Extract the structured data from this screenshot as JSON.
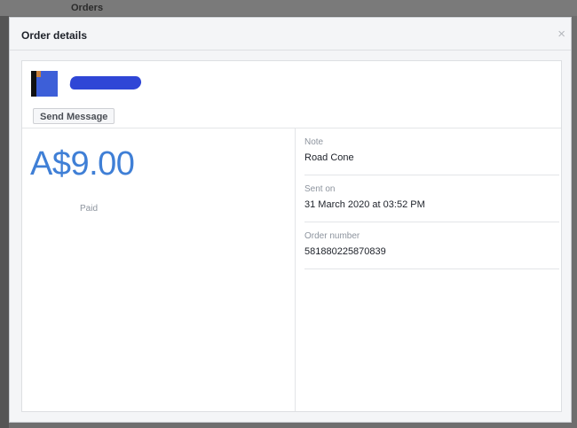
{
  "background": {
    "page_title": "Orders"
  },
  "dialog": {
    "title": "Order details",
    "close_glyph": "×"
  },
  "customer": {
    "send_message_label": "Send Message"
  },
  "order": {
    "amount": "A$9.00",
    "status": "Paid",
    "fields": [
      {
        "label": "Note",
        "value": "Road Cone"
      },
      {
        "label": "Sent on",
        "value": "31 March 2020 at 03:52 PM"
      },
      {
        "label": "Order number",
        "value": "581880225870839"
      }
    ]
  },
  "colors": {
    "amount": "#3f7fd6",
    "redaction": "#2f46d6"
  }
}
